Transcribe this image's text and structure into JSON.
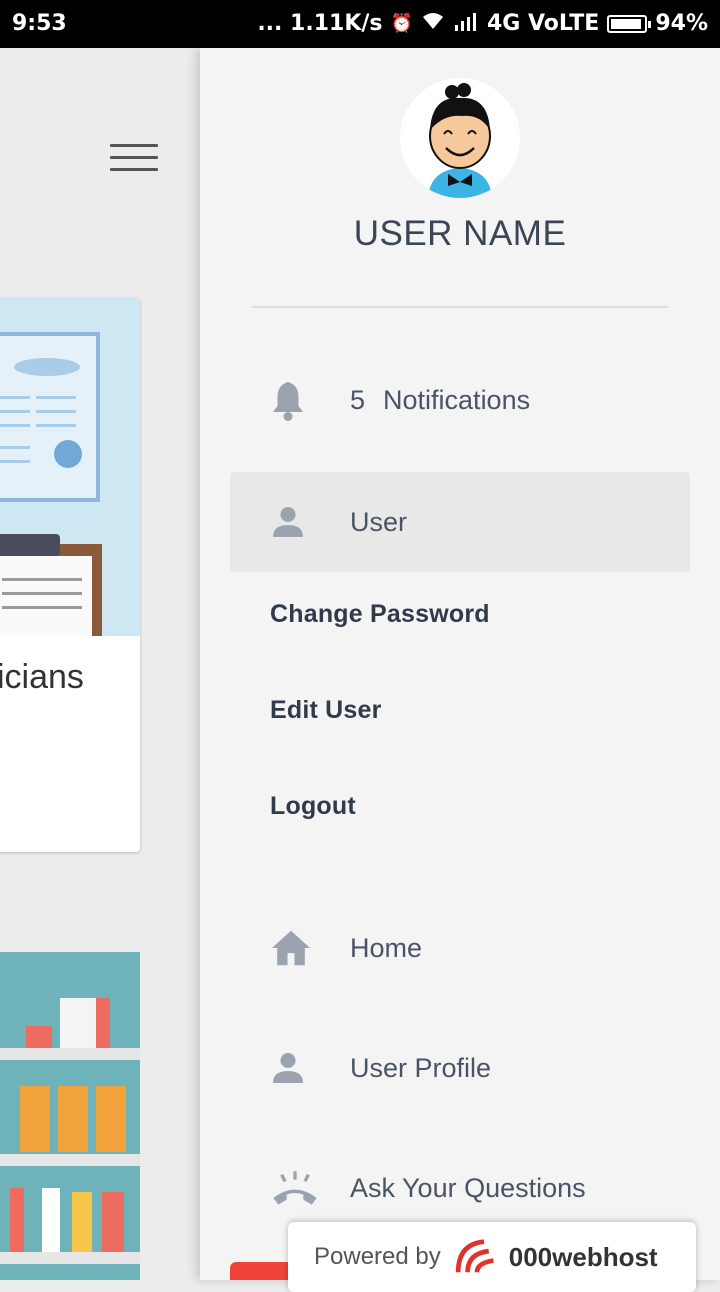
{
  "status_bar": {
    "time": "9:53",
    "net_speed": "... 1.11K/s",
    "network": "4G VoLTE",
    "battery_text": "94%",
    "battery_level": 0.94
  },
  "background_page": {
    "card1_caption": "sicians"
  },
  "drawer": {
    "user_name": "USER NAME",
    "notifications": {
      "count": "5",
      "label": "Notifications"
    },
    "user_label": "User",
    "user_submenu": [
      "Change Password",
      "Edit User",
      "Logout"
    ],
    "nav": {
      "home": "Home",
      "user_profile": "User Profile",
      "ask_questions": "Ask Your Questions"
    }
  },
  "badge": {
    "powered_by": "Powered by",
    "brand": "000webhost"
  },
  "colors": {
    "drawer_bg": "#f4f4f4",
    "text_dark": "#3a4556",
    "icon_gray": "#9aa3af",
    "accent_red": "#f0443a"
  }
}
